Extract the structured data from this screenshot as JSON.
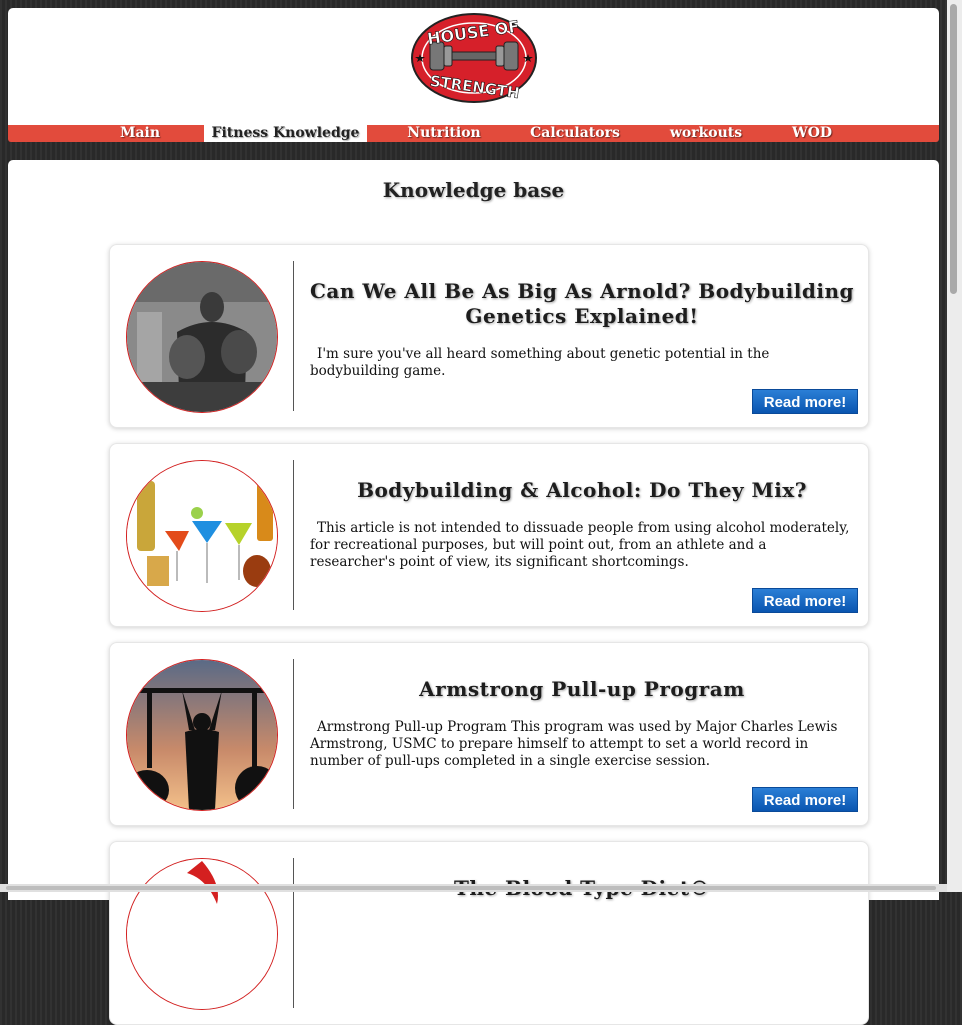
{
  "brand": {
    "logo_line1": "HOUSE OF",
    "logo_line2": "STRENGTH",
    "accent_color": "#e24b3c",
    "button_color": "#1565c0"
  },
  "nav": {
    "items": [
      {
        "label": "Main",
        "active": false
      },
      {
        "label": "Fitness Knowledge",
        "active": true
      },
      {
        "label": "Nutrition",
        "active": false
      },
      {
        "label": "Calculators",
        "active": false
      },
      {
        "label": "workouts",
        "active": false
      },
      {
        "label": "WOD",
        "active": false
      }
    ]
  },
  "page": {
    "title": "Knowledge base"
  },
  "articles": [
    {
      "title": "Can We All Be As Big As Arnold? Bodybuilding Genetics Explained!",
      "excerpt": "I'm sure you've all heard something about genetic potential in the bodybuilding game.",
      "button": "Read more!",
      "image_icon": "bodybuilder-photo"
    },
    {
      "title": "Bodybuilding & Alcohol: Do They Mix?",
      "excerpt": "This article is not intended to dissuade people from using alcohol moderately, for recreational purposes, but will point out, from an athlete and a researcher's point of view, its significant shortcomings.",
      "button": "Read more!",
      "image_icon": "cocktail-glasses-photo"
    },
    {
      "title": "Armstrong Pull-up Program",
      "excerpt": "Armstrong Pull-up Program This program was used by Major Charles Lewis Armstrong, USMC to prepare himself to attempt to set a world record in number of pull-ups completed in a single exercise session.",
      "button": "Read more!",
      "image_icon": "pull-up-silhouette-photo"
    },
    {
      "title": "The Blood Type Diet®",
      "image_icon": "blood-drop-photo"
    }
  ]
}
